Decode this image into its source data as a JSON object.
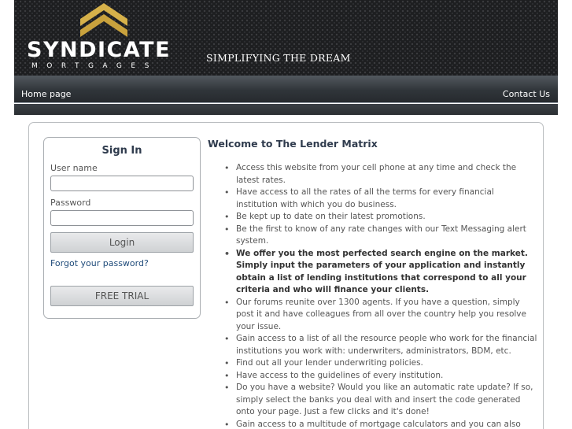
{
  "brand": {
    "name": "SYNDICATE",
    "subtitle": "MORTGAGES",
    "tagline": "SIMPLIFYING THE DREAM",
    "colors": {
      "gold": "#d6b14a",
      "dark": "#1d1e20"
    }
  },
  "nav": {
    "home": "Home page",
    "contact": "Contact Us"
  },
  "signin": {
    "title": "Sign In",
    "username_label": "User name",
    "username_value": "",
    "password_label": "Password",
    "password_value": "",
    "login_button": "Login",
    "forgot_link": "Forgot your password?",
    "free_trial_button": "FREE TRIAL"
  },
  "main": {
    "heading": "Welcome to The Lender Matrix",
    "bullets": [
      "Access this website from your cell phone at any time and check the latest rates.",
      "Have access to all the rates of all the terms for every financial institution with which you do business.",
      "Be kept up to date on their latest promotions.",
      "Be the first to know of any rate changes with our Text Messaging alert system.",
      "We offer you the most perfected search engine on the market. Simply input the parameters of your application and instantly obtain a list of lending institutions that correspond to all your criteria and who will finance your clients.",
      "Our forums reunite over 1300 agents. If you have a question, simply post it and have colleagues from all over the country help you resolve your issue.",
      "Gain access to a list of all the resource people who work for the financial institutions you work with: underwriters, administrators, BDM, etc.",
      "Find out all your lender underwriting policies.",
      "Have access to the guidelines of every institution.",
      "Do you have a website? Would you like an automatic rate update? If so, simply select the banks you deal with and insert the code generated onto your page. Just a few clicks and it's done!",
      "Gain access to a multitude of mortgage calculators and you can also have them on your website."
    ]
  }
}
